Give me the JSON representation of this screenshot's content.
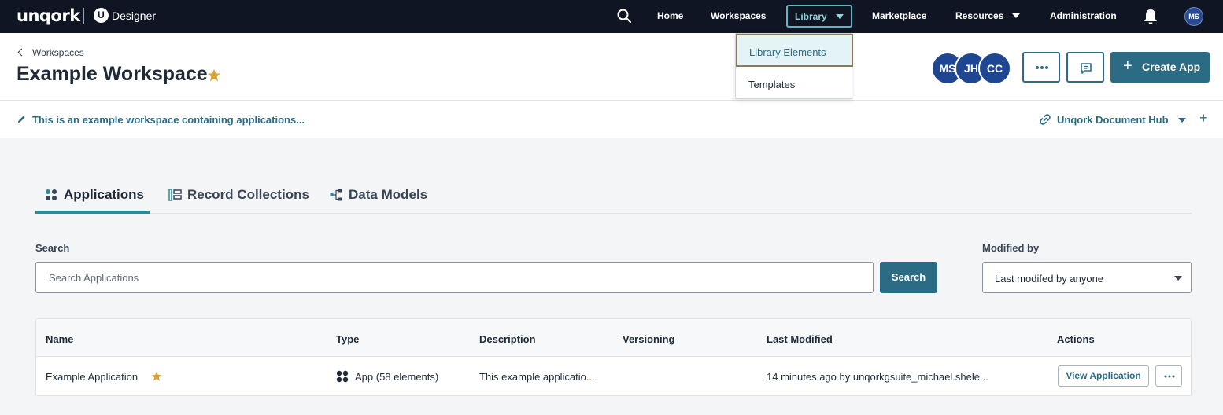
{
  "nav": {
    "brand": "unqork",
    "product_badge": "U",
    "product": "Designer",
    "items": {
      "home": "Home",
      "workspaces": "Workspaces",
      "library": "Library",
      "marketplace": "Marketplace",
      "resources": "Resources",
      "administration": "Administration"
    },
    "user_initials": "MS",
    "library_menu": [
      "Library Elements",
      "Templates"
    ]
  },
  "header": {
    "breadcrumb": "Workspaces",
    "title": "Example Workspace",
    "collaborators": [
      "MS",
      "JH",
      "CC"
    ],
    "create_label": "Create App",
    "create_icon": "+"
  },
  "description_bar": {
    "text": "This is an example workspace containing applications...",
    "hub_label": "Unqork Document Hub",
    "add_icon": "+"
  },
  "tabs": [
    "Applications",
    "Record Collections",
    "Data Models"
  ],
  "search": {
    "label": "Search",
    "placeholder": "Search Applications",
    "button": "Search",
    "modified_label": "Modified by",
    "modified_value": "Last modifed by anyone"
  },
  "table": {
    "headers": [
      "Name",
      "Type",
      "Description",
      "Versioning",
      "Last Modified",
      "Actions"
    ],
    "rows": [
      {
        "name": "Example Application",
        "type": "App (58 elements)",
        "description": "This example applicatio...",
        "versioning": "",
        "last_modified": "14 minutes ago by unqorkgsuite_michael.shele...",
        "view_label": "View Application"
      }
    ]
  },
  "colors": {
    "nav_bg": "#0f1522",
    "accent": "#2b6b84",
    "star": "#d9a53a",
    "avatar": "#1f4691"
  }
}
